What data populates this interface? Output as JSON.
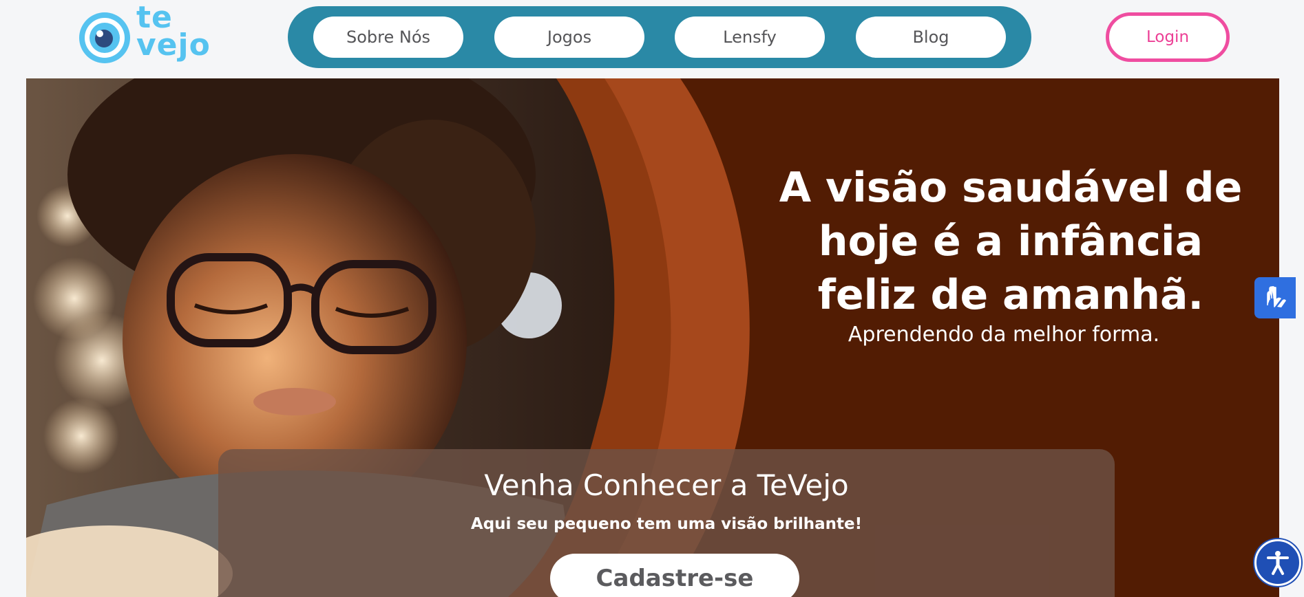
{
  "brand": {
    "line1": "te",
    "line2": "vejo",
    "logo_icon": "eye-logo-icon",
    "color": "#56c3f0"
  },
  "nav": {
    "items": [
      {
        "label": "Sobre Nós"
      },
      {
        "label": "Jogos"
      },
      {
        "label": "Lensfy"
      },
      {
        "label": "Blog"
      }
    ],
    "background": "#2a89a6"
  },
  "login": {
    "label": "Login",
    "accent": "#ec3f95"
  },
  "hero": {
    "headline": "A visão saudável de hoje é a infância feliz de amanhã.",
    "headline_lines": [
      "A visão saudável de",
      "hoje é a infância",
      "feliz de amanhã."
    ],
    "subheadline": "Aprendendo da melhor forma.",
    "background": "#521c03",
    "image_icon": "child-with-glasses-reading-photo"
  },
  "cta": {
    "title": "Venha Conhecer a TeVejo",
    "subtitle": "Aqui seu pequeno tem uma visão brilhante!",
    "button_label": "Cadastre-se"
  },
  "widgets": {
    "vlibras_icon": "sign-language-hands-icon",
    "accessibility_icon": "accessibility-person-icon"
  }
}
